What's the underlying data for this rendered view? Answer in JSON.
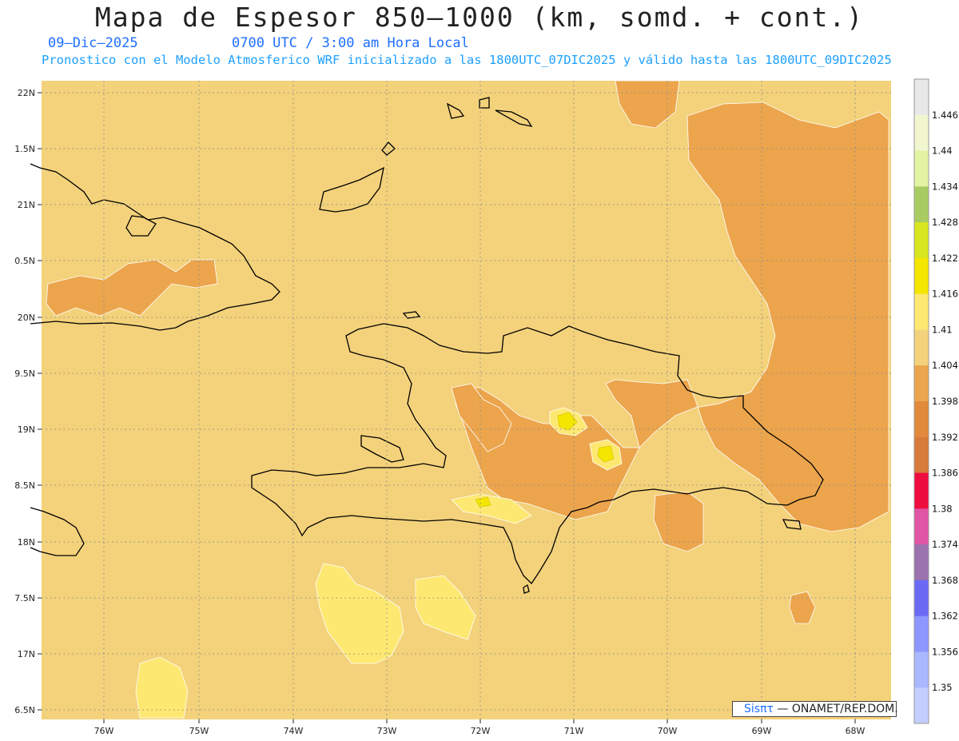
{
  "header": {
    "title": "Mapa de Espesor 850—1000 (km, somd. + cont.)",
    "date": "09—Dic—2025",
    "time": "0700 UTC / 3:00 am Hora Local",
    "forecast_info": "Pronostico con el Modelo Atmosferico WRF inicializado a las 1800UTC_07DIC2025 y válido hasta las  1800UTC_09DIC2025"
  },
  "axes": {
    "lat_labels": [
      "22N",
      "1.5N",
      "21N",
      "0.5N",
      "20N",
      "9.5N",
      "19N",
      "8.5N",
      "18N",
      "7.5N",
      "17N",
      "6.5N"
    ],
    "lon_labels": [
      "76W",
      "75W",
      "74W",
      "73W",
      "72W",
      "71W",
      "70W",
      "69W",
      "68W"
    ]
  },
  "colorbar": {
    "labels": [
      "1.446",
      "1.44",
      "1.434",
      "1.428",
      "1.422",
      "1.416",
      "1.41",
      "1.404",
      "1.398",
      "1.392",
      "1.386",
      "1.38",
      "1.374",
      "1.368",
      "1.362",
      "1.356",
      "1.35"
    ],
    "colors": [
      "#e8e8e8",
      "#f2f6cf",
      "#e2f3a3",
      "#a9cc62",
      "#d8e620",
      "#f4e600",
      "#fde872",
      "#f3d27b",
      "#eca54c",
      "#e18a3c",
      "#d77a3a",
      "#ef0c3e",
      "#e055a4",
      "#9b72ad",
      "#6a6af5",
      "#8c98ff",
      "#a9b8ff",
      "#c4ceff"
    ]
  },
  "legend_fill": {
    "background_band": "1.404–1.41",
    "main_contour_band": "1.398–1.404",
    "max_band": "1.416–1.422"
  },
  "credit": {
    "brand": "Sisπτ",
    "text": " — ONAMET/REP.DOM."
  }
}
